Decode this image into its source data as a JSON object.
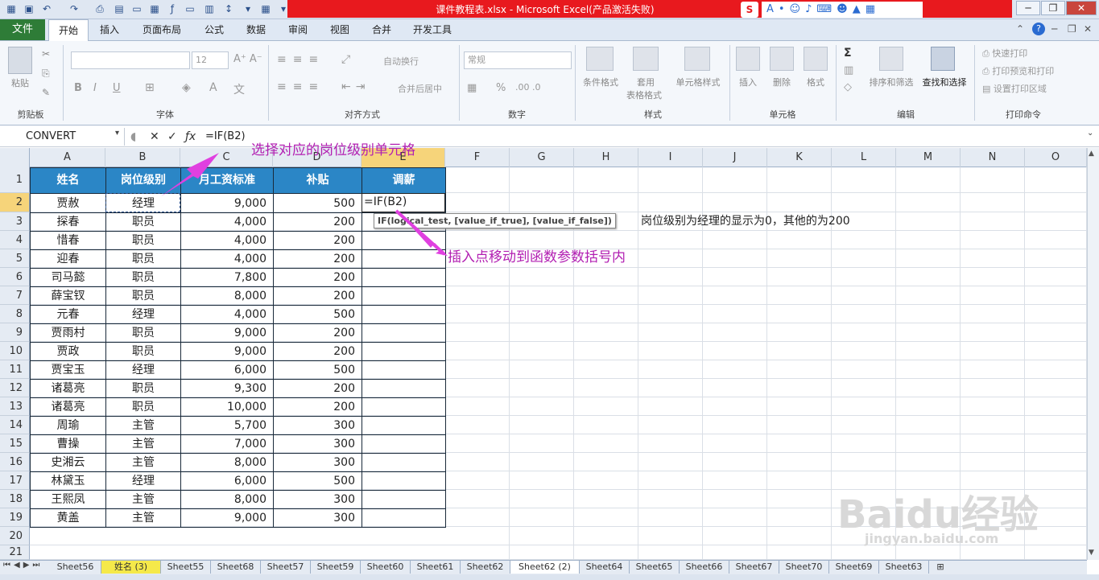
{
  "window": {
    "title": "课件教程表.xlsx - Microsoft Excel(产品激活失败)",
    "controls": {
      "minimize": "─",
      "restore": "❐",
      "close": "✕"
    }
  },
  "ribbon_tabs": {
    "file": "文件",
    "items": [
      "开始",
      "插入",
      "页面布局",
      "公式",
      "数据",
      "审阅",
      "视图",
      "合并",
      "开发工具"
    ]
  },
  "ribbon": {
    "clipboard": {
      "paste": "粘贴",
      "label": "剪贴板"
    },
    "font": {
      "size": "12",
      "label": "字体",
      "bold": "B",
      "italic": "I",
      "underline": "U"
    },
    "alignment": {
      "wrap": "自动换行",
      "merge": "合并后居中",
      "label": "对齐方式"
    },
    "number": {
      "format": "常规",
      "percent": "%",
      "label": "数字"
    },
    "styles": {
      "cond": "条件格式",
      "table1": "套用",
      "table2": "表格格式",
      "cell": "单元格样式",
      "label": "样式"
    },
    "cells": {
      "insert": "插入",
      "delete": "删除",
      "format": "格式",
      "label": "单元格"
    },
    "editing": {
      "sum": "Σ",
      "sort": "排序和筛选",
      "find": "查找和选择",
      "label": "编辑"
    },
    "print": {
      "quick": "快速打印",
      "preview": "打印预览和打印",
      "area": "设置打印区域",
      "label": "打印命令"
    }
  },
  "formula_bar": {
    "name_box": "CONVERT",
    "formula": "=IF(B2)"
  },
  "columns": [
    "A",
    "B",
    "C",
    "D",
    "E",
    "F",
    "G",
    "H",
    "I",
    "J",
    "K",
    "L",
    "M",
    "N",
    "O"
  ],
  "rows": [
    "1",
    "2",
    "3",
    "4",
    "5",
    "6",
    "7",
    "8",
    "9",
    "10",
    "11",
    "12",
    "13",
    "14",
    "15",
    "16",
    "17",
    "18",
    "19",
    "20",
    "21"
  ],
  "table": {
    "headers": [
      "姓名",
      "岗位级别",
      "月工资标准",
      "补贴",
      "调薪"
    ],
    "rows": [
      [
        "贾赦",
        "经理",
        "9,000",
        "500",
        "=IF(B2)"
      ],
      [
        "探春",
        "职员",
        "4,000",
        "200",
        ""
      ],
      [
        "惜春",
        "职员",
        "4,000",
        "200",
        ""
      ],
      [
        "迎春",
        "职员",
        "4,000",
        "200",
        ""
      ],
      [
        "司马懿",
        "职员",
        "7,800",
        "200",
        ""
      ],
      [
        "薛宝钗",
        "职员",
        "8,000",
        "200",
        ""
      ],
      [
        "元春",
        "经理",
        "4,000",
        "500",
        ""
      ],
      [
        "贾雨村",
        "职员",
        "9,000",
        "200",
        ""
      ],
      [
        "贾政",
        "职员",
        "9,000",
        "200",
        ""
      ],
      [
        "贾宝玉",
        "经理",
        "6,000",
        "500",
        ""
      ],
      [
        "诸葛亮",
        "职员",
        "9,300",
        "200",
        ""
      ],
      [
        "诸葛亮",
        "职员",
        "10,000",
        "200",
        ""
      ],
      [
        "周瑜",
        "主管",
        "5,700",
        "300",
        ""
      ],
      [
        "曹操",
        "主管",
        "7,000",
        "300",
        ""
      ],
      [
        "史湘云",
        "主管",
        "8,000",
        "300",
        ""
      ],
      [
        "林黛玉",
        "经理",
        "6,000",
        "500",
        ""
      ],
      [
        "王熙凤",
        "主管",
        "8,000",
        "300",
        ""
      ],
      [
        "黄盖",
        "主管",
        "9,000",
        "300",
        ""
      ]
    ]
  },
  "tooltip": "IF(logical_test, [value_if_true], [value_if_false])",
  "note": "岗位级别为经理的显示为0，其他的为200",
  "annotations": {
    "select": "选择对应的岗位级别单元格",
    "cursor": "插入点移动到函数参数括号内"
  },
  "sheets": [
    "Sheet56",
    "姓名 (3)",
    "Sheet55",
    "Sheet68",
    "Sheet57",
    "Sheet59",
    "Sheet60",
    "Sheet61",
    "Sheet62",
    "Sheet62 (2)",
    "Sheet64",
    "Sheet65",
    "Sheet66",
    "Sheet67",
    "Sheet70",
    "Sheet69",
    "Sheet63"
  ],
  "watermark": {
    "brand": "Baidu经验",
    "url": "jingyan.baidu.com"
  },
  "colors": {
    "header_fill": "#2b86c6",
    "file_tab": "#2e7c37",
    "annotation": "#b21fb2",
    "title_bar": "#e8191e"
  }
}
